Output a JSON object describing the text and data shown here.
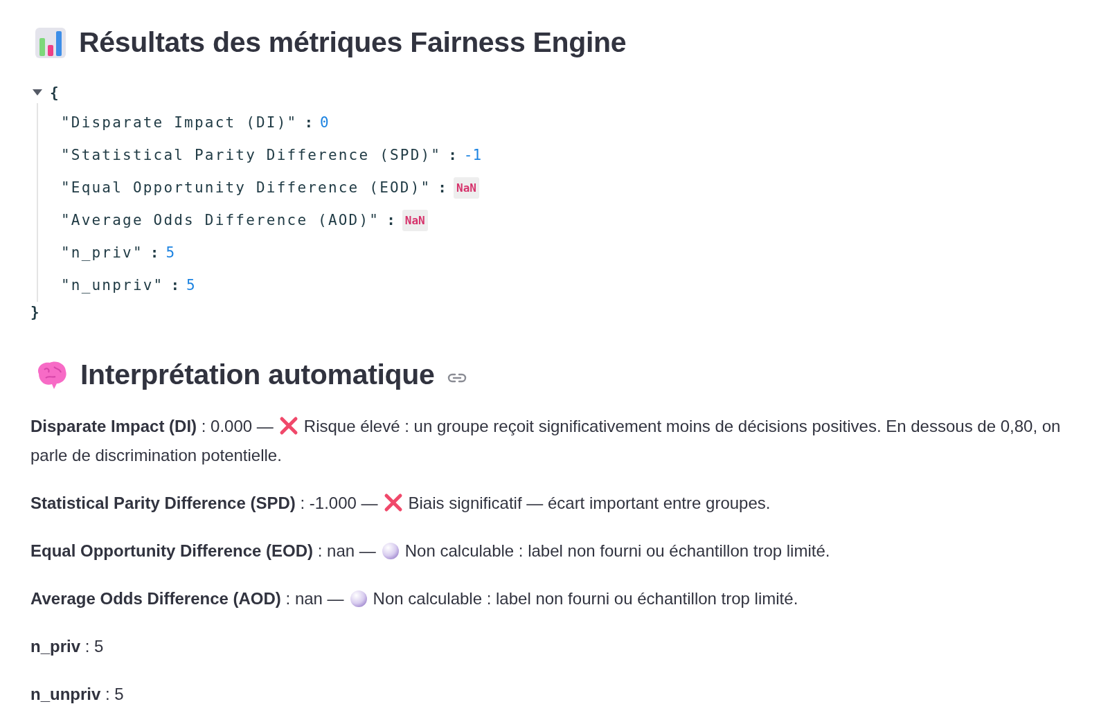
{
  "results_heading": {
    "text": "Résultats des métriques Fairness Engine"
  },
  "json_view": {
    "expanded": true,
    "open": "{",
    "close": "}",
    "entries": [
      {
        "key": "\"Disparate Impact (DI)\"",
        "separator": ":",
        "value": "0",
        "kind": "number"
      },
      {
        "key": "\"Statistical Parity Difference (SPD)\"",
        "separator": ":",
        "value": "-1",
        "kind": "number"
      },
      {
        "key": "\"Equal Opportunity Difference (EOD)\"",
        "separator": ":",
        "value": "NaN",
        "kind": "nan"
      },
      {
        "key": "\"Average Odds Difference (AOD)\"",
        "separator": ":",
        "value": "NaN",
        "kind": "nan"
      },
      {
        "key": "\"n_priv\"",
        "separator": ":",
        "value": "5",
        "kind": "number"
      },
      {
        "key": "\"n_unpriv\"",
        "separator": ":",
        "value": "5",
        "kind": "number"
      }
    ]
  },
  "interpretation_heading": {
    "text": "Interprétation automatique",
    "anchor_link": true
  },
  "interpretations": [
    {
      "kind": "flagged",
      "lead": "**Disparate Impact (DI)** : 0.000 —",
      "message_lines": [
        "Risque élevé : un groupe reçoit significativement moins de décisions positives. En dessous de 0,80, on",
        "parle de discrimination potentielle."
      ]
    },
    {
      "kind": "flagged",
      "lead": "**Statistical Parity Difference (SPD)** : -1.000 —",
      "message_lines": [
        "Biais significatif — écart important entre groupes."
      ]
    },
    {
      "kind": "uncomputable",
      "lead": "**Equal Opportunity Difference (EOD)** : nan —",
      "message_lines": [
        "Non calculable : label non fourni ou échantillon trop limité."
      ]
    },
    {
      "kind": "uncomputable",
      "lead": "**Average Odds Difference (AOD)** : nan —",
      "message_lines": [
        "Non calculable : label non fourni ou échantillon trop limité."
      ]
    },
    {
      "kind": "count",
      "lead": "**n_priv** : 5"
    },
    {
      "kind": "count",
      "lead": "**n_unpriv** : 5"
    }
  ]
}
